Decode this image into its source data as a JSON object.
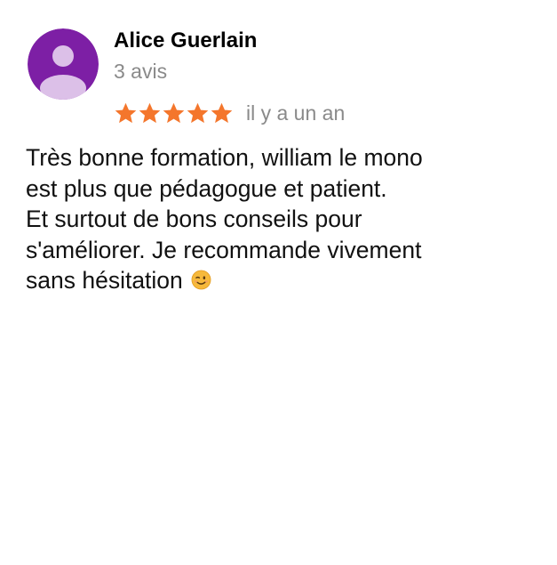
{
  "review": {
    "author": "Alice Guerlain",
    "review_count": "3 avis",
    "rating": 5,
    "rating_max": 5,
    "date": "il y a un an",
    "text_lines": [
      "Très bonne formation, william le mono",
      "est plus que pédagogue et patient.",
      "Et surtout de bons conseils pour",
      "s'améliorer. Je recommande vivement",
      "sans hésitation"
    ],
    "emoji": "winking-face"
  },
  "colors": {
    "avatar_background": "#7d1fa5",
    "avatar_silhouette": "#dcc0e8",
    "star_fill": "#f4762c",
    "secondary_text": "#8a8a8a"
  }
}
